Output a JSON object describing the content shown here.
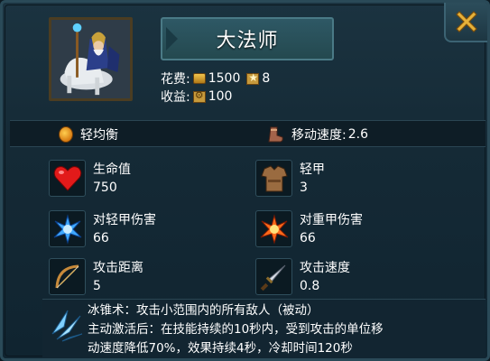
{
  "unit": {
    "name": "大法师",
    "cost_label": "花费:",
    "gold_cost": "1500",
    "star_cost": "8",
    "income_label": "收益:",
    "income": "100"
  },
  "attributes": {
    "armor_type": "轻均衡",
    "move_speed_label": "移动速度:",
    "move_speed": "2.6"
  },
  "stats": [
    {
      "label": "生命值",
      "value": "750",
      "icon": "heart-icon"
    },
    {
      "label": "轻甲",
      "value": "3",
      "icon": "light-armor-icon"
    },
    {
      "label": "对轻甲伤害",
      "value": "66",
      "icon": "ice-burst-icon"
    },
    {
      "label": "对重甲伤害",
      "value": "66",
      "icon": "fire-burst-icon"
    },
    {
      "label": "攻击距离",
      "value": "5",
      "icon": "bow-icon"
    },
    {
      "label": "攻击速度",
      "value": "0.8",
      "icon": "dagger-icon"
    }
  ],
  "skill": {
    "line1": "冰锥术：攻击小范围内的所有敌人（被动）",
    "line2": "主动激活后：在技能持续的10秒内，受到攻击的单位移",
    "line3": "动速度降低70%，效果持续4秒，冷却时间120秒",
    "icon": "ice-shard-icon"
  },
  "colors": {
    "panel_bg": "#152a36",
    "close_x": "#e6b23a",
    "name_plate": "#2e5865"
  }
}
